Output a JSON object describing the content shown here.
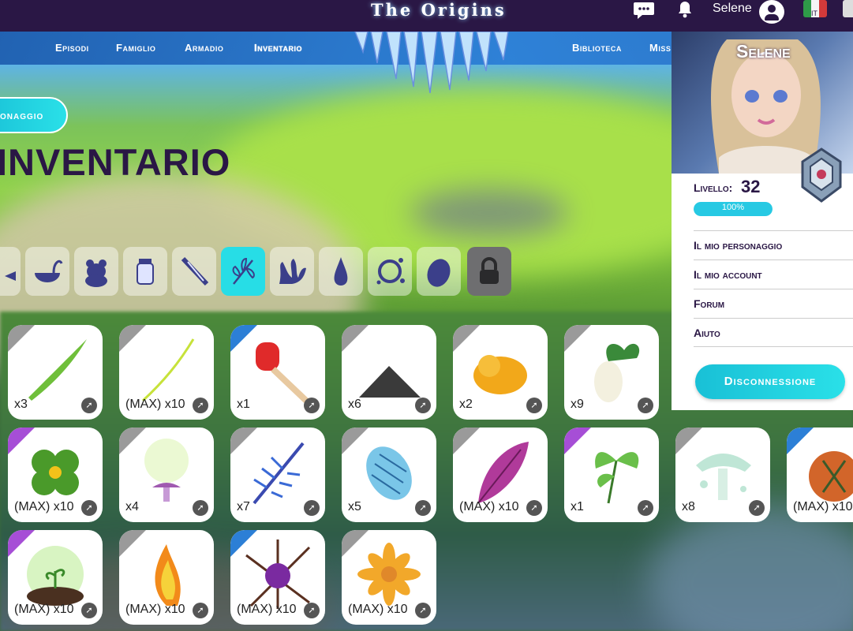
{
  "header": {
    "logo": "The Origins",
    "user_name": "Selene",
    "language": "IT"
  },
  "nav": {
    "items": [
      "Episodi",
      "Famiglio",
      "Armadio",
      "Inventario",
      "Biblioteca",
      "Miss"
    ],
    "active": "Inventario"
  },
  "page": {
    "character_button": "onaggio",
    "title": "INVENTARIO"
  },
  "categories": [
    {
      "icon": "dish-icon",
      "active": false
    },
    {
      "icon": "ladle-icon",
      "active": false
    },
    {
      "icon": "animal-icon",
      "active": false
    },
    {
      "icon": "jar-icon",
      "active": false
    },
    {
      "icon": "feather-icon",
      "active": false
    },
    {
      "icon": "herb-icon",
      "active": true
    },
    {
      "icon": "coral-icon",
      "active": false
    },
    {
      "icon": "drop-icon",
      "active": false
    },
    {
      "icon": "bubble-icon",
      "active": false
    },
    {
      "icon": "stone-icon",
      "active": false
    },
    {
      "icon": "lock-icon",
      "active": false,
      "locked": true
    }
  ],
  "items": [
    {
      "name": "grass-blade",
      "qty": "x3",
      "rarity": "grey"
    },
    {
      "name": "thin-stalk",
      "qty": "(MAX) x10",
      "rarity": "grey"
    },
    {
      "name": "honey-dipper",
      "qty": "x1",
      "rarity": "blue"
    },
    {
      "name": "ash-pile",
      "qty": "x6",
      "rarity": "grey"
    },
    {
      "name": "amber-resin",
      "qty": "x2",
      "rarity": "grey"
    },
    {
      "name": "white-radish",
      "qty": "x9",
      "rarity": "grey"
    },
    {
      "name": "four-leaf-clover",
      "qty": "(MAX) x10",
      "rarity": "purple"
    },
    {
      "name": "glowing-mushroom",
      "qty": "x4",
      "rarity": "grey"
    },
    {
      "name": "blue-fern",
      "qty": "x7",
      "rarity": "grey"
    },
    {
      "name": "blue-pinecone",
      "qty": "x5",
      "rarity": "grey"
    },
    {
      "name": "purple-leaf",
      "qty": "(MAX) x10",
      "rarity": "grey"
    },
    {
      "name": "green-sprig",
      "qty": "x1",
      "rarity": "purple"
    },
    {
      "name": "slime-mushroom",
      "qty": "x8",
      "rarity": "grey"
    },
    {
      "name": "pomegranate",
      "qty": "(MAX) x10",
      "rarity": "blue"
    },
    {
      "name": "sprouting-soil",
      "qty": "(MAX) x10",
      "rarity": "purple"
    },
    {
      "name": "fire-flower",
      "qty": "(MAX) x10",
      "rarity": "grey"
    },
    {
      "name": "thorn-berry",
      "qty": "(MAX) x10",
      "rarity": "blue"
    },
    {
      "name": "orange-blossom",
      "qty": "(MAX) x10",
      "rarity": "grey"
    }
  ],
  "profile": {
    "name": "Selene",
    "level_label": "Livello:",
    "level": "32",
    "xp_percent_label": "100%",
    "xp_fraction": 1.0,
    "menu": [
      "Il mio personaggio",
      "Il mio account",
      "Forum",
      "Aiuto"
    ],
    "logout": "Disconnessione"
  },
  "colors": {
    "topbar": "#2a1745",
    "accent": "#27dde6",
    "nav": "#2c7fd6"
  }
}
